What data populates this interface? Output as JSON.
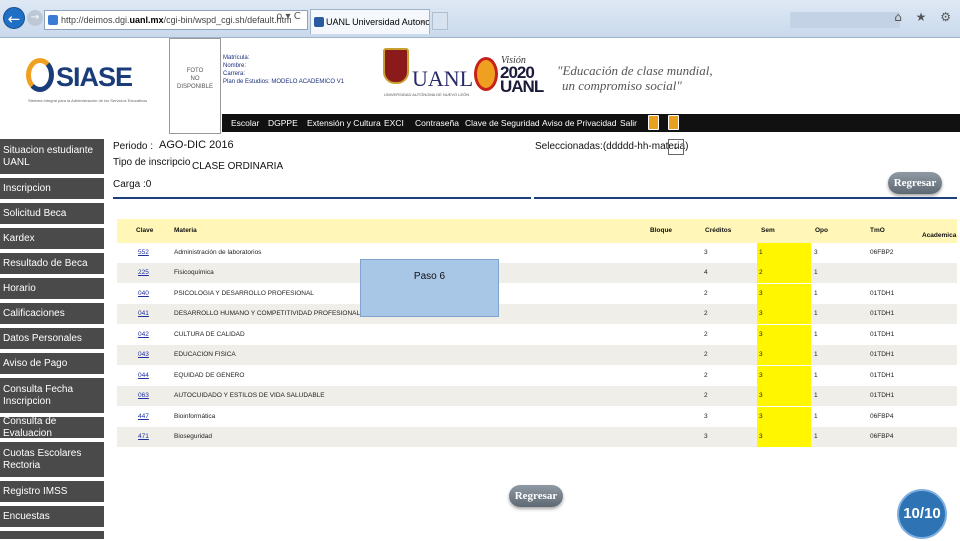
{
  "browser": {
    "url_prefix": "http://deimos.dgi.",
    "url_bold": "uanl.mx",
    "url_suffix": "/cgi-bin/wspd_cgi.sh/default.htm",
    "tab_title": "UANL Universidad Autono...",
    "tab_close": "×",
    "back": "←",
    "forward": "→",
    "addr_tools": "ρ ▾ C",
    "toolbar_icons": "⌂ ★ ⚙"
  },
  "header": {
    "logo_text": "SIASE",
    "logo_sub": "Sistema Integral para la Administración de los Servicios Educativos",
    "photo_text": [
      "FOTO",
      "NO",
      "DISPONIBLE"
    ],
    "student": {
      "matricula_label": "Matrícula:",
      "nombre_label": "Nombre:",
      "nombre_value": "",
      "carrera_label": "Carrera:",
      "carrera_value": "",
      "plan_label": "Plan de Estudios:",
      "plan_value": "MODELO ACADEMICO V1"
    },
    "uanl_text": "UANL",
    "uanl_sub": "UNIVERSIDAD AUTÓNOMA DE NUEVO LEÓN",
    "vision_small": "Visión",
    "vision_big_1": "2020",
    "vision_big_2": "UANL",
    "slogan_1": "\"Educación de clase mundial,",
    "slogan_2": "un compromiso social\""
  },
  "topnav": {
    "items": [
      "Escolar",
      "DGPPE",
      "Extensión y Cultura",
      "EXCI",
      "Contraseña",
      "Clave de Seguridad",
      "Aviso de Privacidad",
      "Salir"
    ],
    "icons": [
      "facebook-icon",
      "twitter-icon"
    ]
  },
  "sidebar": {
    "items": [
      "Situacion estudiante UANL",
      "Inscripcion",
      "Solicitud Beca",
      "Kardex",
      "Resultado de Beca",
      "Horario",
      "Calificaciones",
      "Datos Personales",
      "Aviso de Pago",
      "Consulta Fecha Inscripcion",
      "Consulta de Evaluacion",
      "Cuotas Escolares Rectoria",
      "Registro IMSS",
      "Encuestas"
    ]
  },
  "main": {
    "periodo_label": "Periodo :",
    "periodo_value": "AGO-DIC 2016",
    "tipo_label": "Tipo de inscripcio",
    "tipo_value": "CLASE ORDINARIA",
    "carga_label": "Carga :0",
    "seleccionadas_label": "Seleccionadas:(ddddd-hh-materia)",
    "select_caret": "⌄",
    "regresar_label": "Regresar",
    "regresar_bottom_label": "Regresar"
  },
  "table": {
    "headers": {
      "clave": "Clave",
      "materia": "Materia",
      "bloque": "Bloque",
      "creditos": "Créditos",
      "sem": "Sem",
      "opo": "Opo",
      "tmo": "TmO",
      "academica": "Academica"
    },
    "rows": [
      {
        "clave": "552",
        "materia": "Administración de laboratorios",
        "creditos": "3",
        "sem": "1",
        "opo": "3",
        "tmo": "06FBP2"
      },
      {
        "clave": "225",
        "materia": "Fisicoquímica",
        "creditos": "4",
        "sem": "2",
        "opo": "1",
        "tmo": ""
      },
      {
        "clave": "040",
        "materia": "PSICOLOGIA Y DESARROLLO PROFESIONAL",
        "creditos": "2",
        "sem": "3",
        "opo": "1",
        "tmo": "01TDH1"
      },
      {
        "clave": "041",
        "materia": "DESARROLLO HUMANO Y COMPETITIVIDAD PROFESIONAL",
        "creditos": "2",
        "sem": "3",
        "opo": "1",
        "tmo": "01TDH1"
      },
      {
        "clave": "042",
        "materia": "CULTURA DE CALIDAD",
        "creditos": "2",
        "sem": "3",
        "opo": "1",
        "tmo": "01TDH1"
      },
      {
        "clave": "043",
        "materia": "EDUCACION FISICA",
        "creditos": "2",
        "sem": "3",
        "opo": "1",
        "tmo": "01TDH1"
      },
      {
        "clave": "044",
        "materia": "EQUIDAD DE GENERO",
        "creditos": "2",
        "sem": "3",
        "opo": "1",
        "tmo": "01TDH1"
      },
      {
        "clave": "063",
        "materia": "AUTOCUIDADO Y ESTILOS DE VIDA SALUDABLE",
        "creditos": "2",
        "sem": "3",
        "opo": "1",
        "tmo": "01TDH1"
      },
      {
        "clave": "447",
        "materia": "Bioinformática",
        "creditos": "3",
        "sem": "3",
        "opo": "1",
        "tmo": "06FBP4"
      },
      {
        "clave": "471",
        "materia": "Bioseguridad",
        "creditos": "3",
        "sem": "3",
        "opo": "1",
        "tmo": "06FBP4"
      }
    ]
  },
  "overlay": {
    "paso_label": "Paso 6",
    "page_badge": "10/10"
  },
  "colors": {
    "accent_blue": "#1f3f7a",
    "sem_highlight": "#fff600",
    "header_row": "#fff6b8",
    "sidebar_bg": "#4a4a4a"
  }
}
